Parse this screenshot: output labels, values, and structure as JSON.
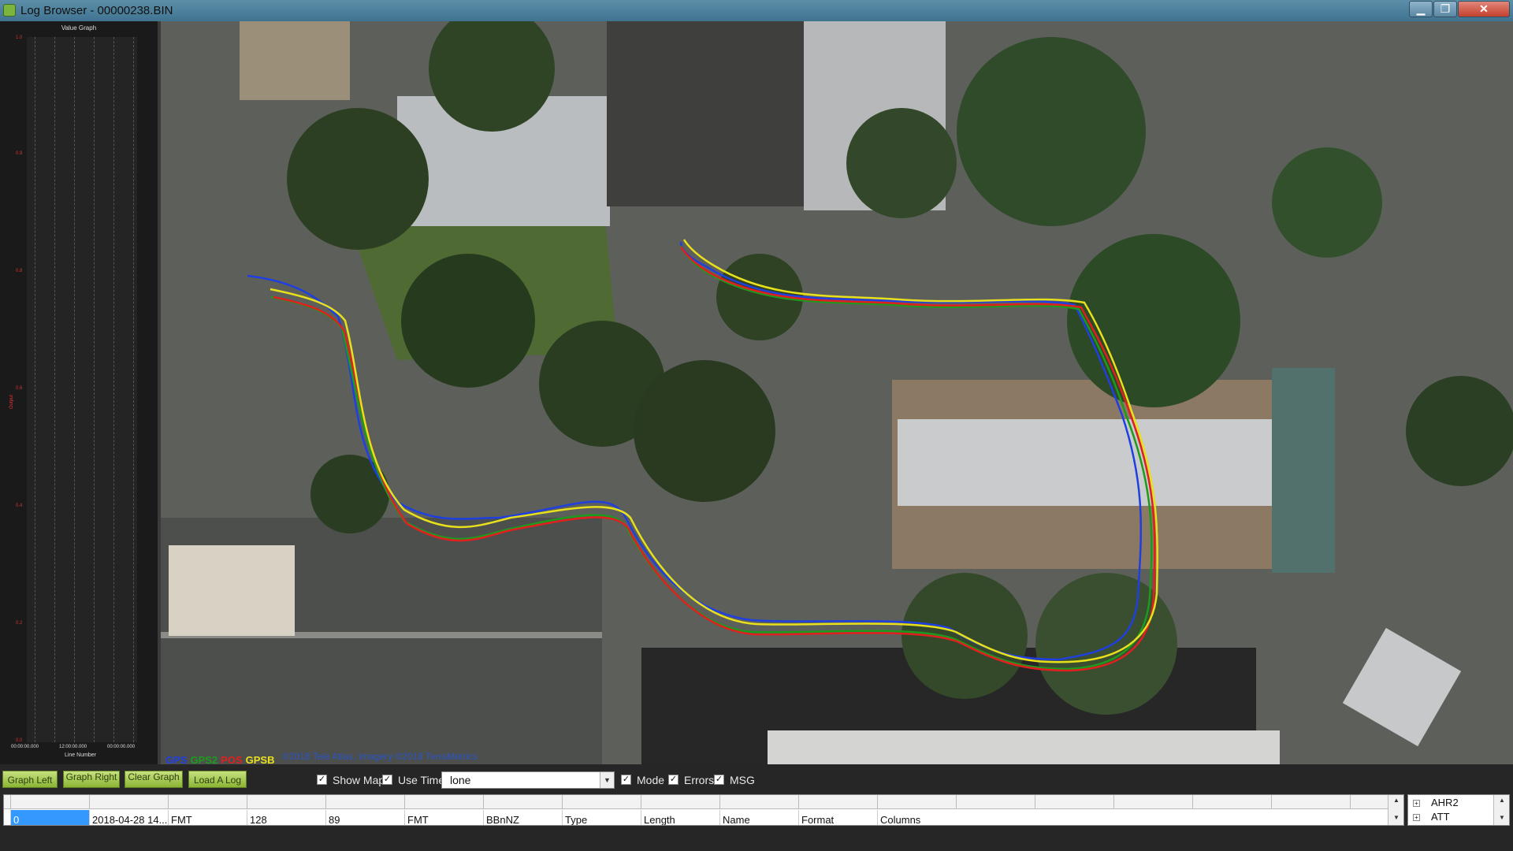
{
  "window": {
    "title": "Log Browser - 00000238.BIN",
    "min_glyph": "▁",
    "max_glyph": "❐",
    "close_glyph": "✕"
  },
  "graph": {
    "title": "Value Graph",
    "yaxis_label": "Output",
    "yticks": [
      "1.0",
      "0.9",
      "0.8",
      "0.6",
      "0.4",
      "0.2",
      "0.0"
    ],
    "xticks": [
      "00:00:00.000",
      "12:00:00.000",
      "00:00:00.000"
    ],
    "xaxis_label": "Line Number"
  },
  "map": {
    "legend": [
      {
        "label": "GPS",
        "color": "#1f3fe0"
      },
      {
        "label": "GPS2",
        "color": "#1c9b1c"
      },
      {
        "label": "POS",
        "color": "#e02020"
      },
      {
        "label": "GPSB",
        "color": "#e8e01c"
      }
    ],
    "attribution": "©2018 Tele Atlas, Imagery ©2018 TerraMetrics"
  },
  "controls": {
    "graph_left": "Graph Left",
    "graph_right": "Graph Right",
    "clear_graph": "Clear Graph",
    "load_log": "Load A Log",
    "show_map": "Show Map",
    "use_time": "Use Time",
    "combo_value": "lone",
    "mode": "Mode",
    "errors": "Errors",
    "msg": "MSG",
    "check_glyph": "✓",
    "combo_arrow": "▼"
  },
  "log_table": {
    "row": [
      "0",
      "2018-04-28 14...",
      "FMT",
      "128",
      "89",
      "FMT",
      "BBnNZ",
      "Type",
      "Length",
      "Name",
      "Format",
      "Columns"
    ],
    "scroll_up": "▲",
    "scroll_down": "▼"
  },
  "message_tree": {
    "items": [
      "AHR2",
      "ATT"
    ],
    "expander": "+"
  }
}
